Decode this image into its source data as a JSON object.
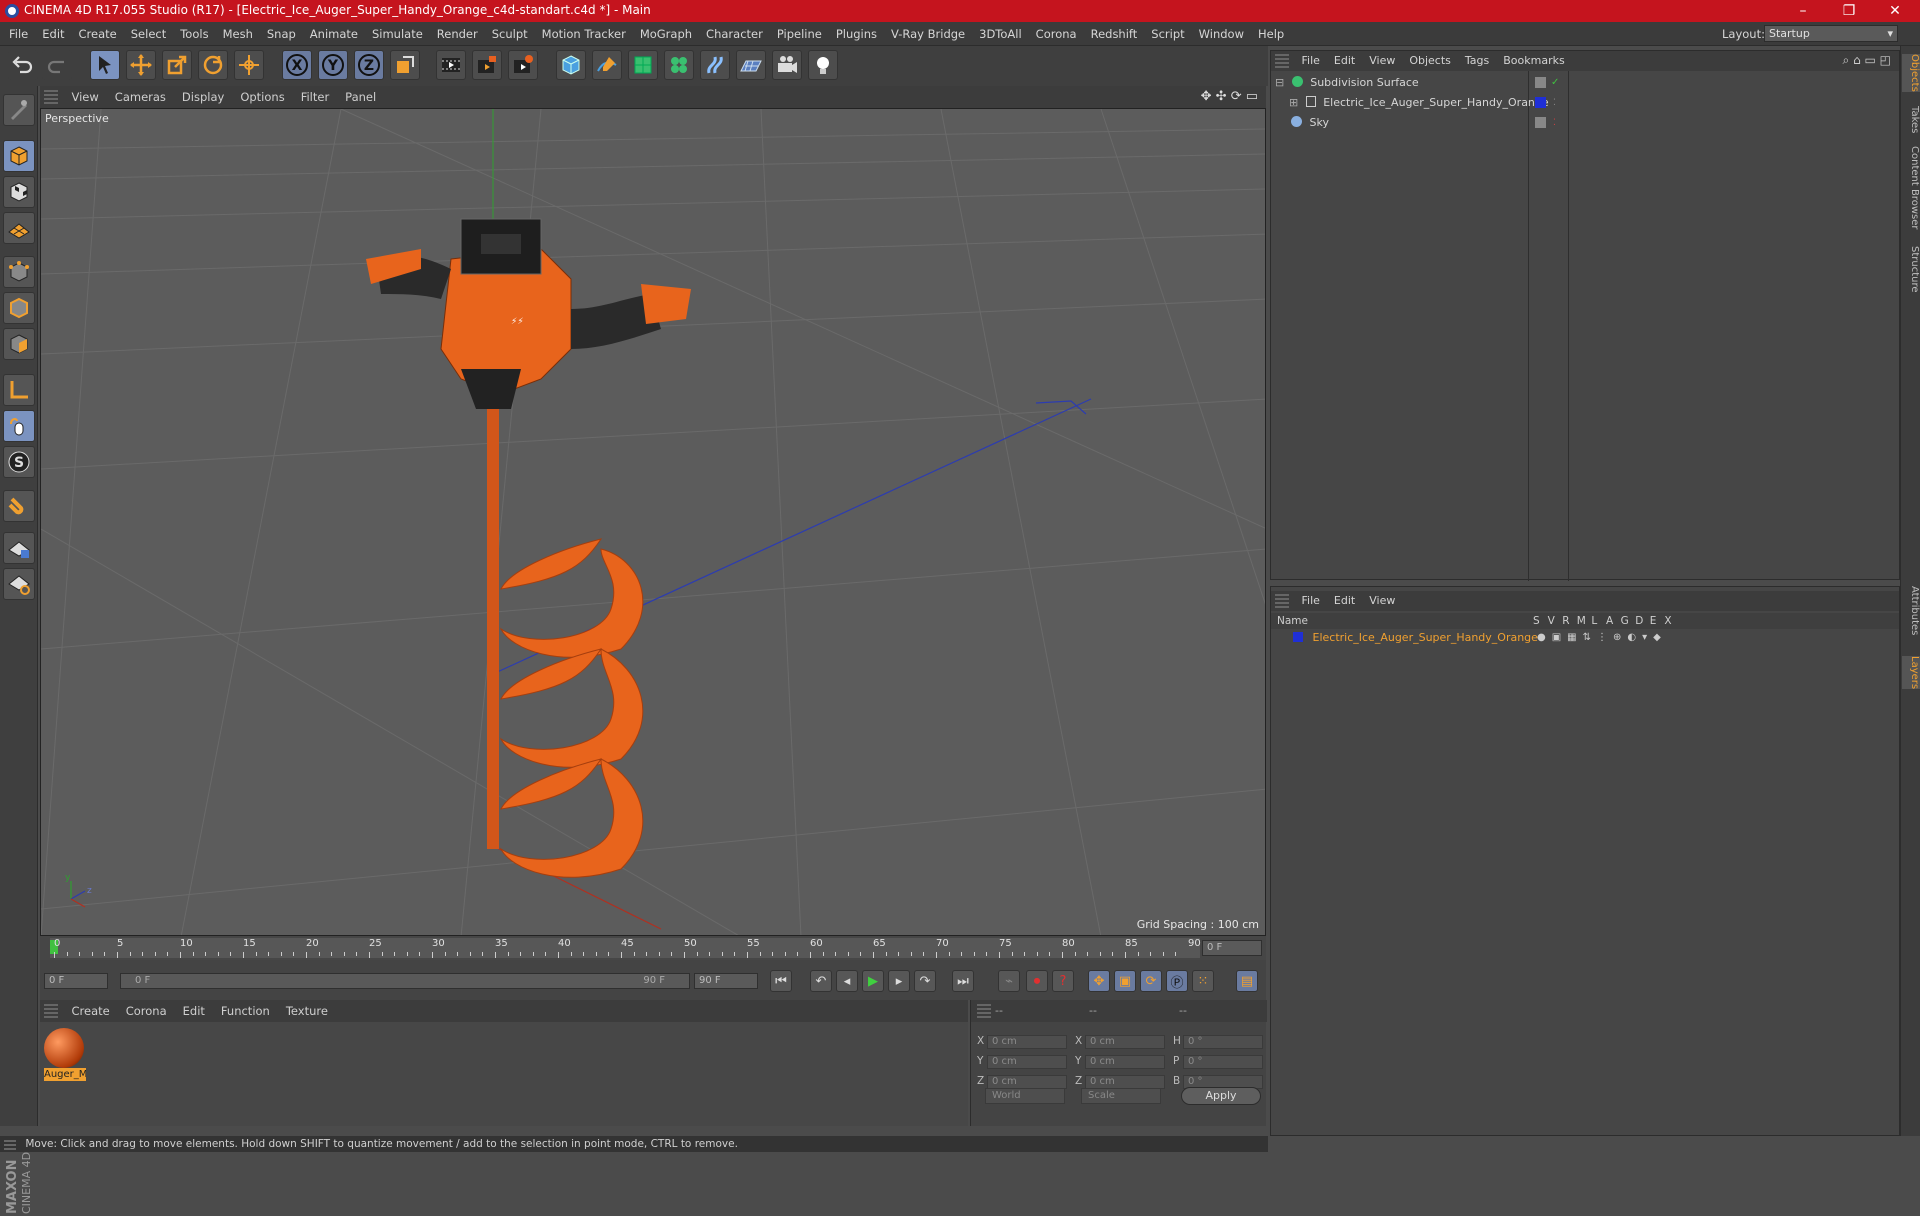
{
  "window": {
    "title": "CINEMA 4D R17.055 Studio (R17) - [Electric_Ice_Auger_Super_Handy_Orange_c4d-standart.c4d *] - Main"
  },
  "menu": {
    "items": [
      "File",
      "Edit",
      "Create",
      "Select",
      "Tools",
      "Mesh",
      "Snap",
      "Animate",
      "Simulate",
      "Render",
      "Sculpt",
      "Motion Tracker",
      "MoGraph",
      "Character",
      "Pipeline",
      "Plugins",
      "V-Ray Bridge",
      "3DToAll",
      "Corona",
      "Redshift",
      "Script",
      "Window",
      "Help"
    ],
    "layout_label": "Layout:",
    "layout_value": "Startup"
  },
  "viewport": {
    "menu": [
      "View",
      "Cameras",
      "Display",
      "Options",
      "Filter",
      "Panel"
    ],
    "label": "Perspective",
    "grid_spacing": "Grid Spacing : 100 cm"
  },
  "timeline": {
    "ticks": [
      "0",
      "5",
      "10",
      "15",
      "20",
      "25",
      "30",
      "35",
      "40",
      "45",
      "50",
      "55",
      "60",
      "65",
      "70",
      "75",
      "80",
      "85",
      "90"
    ],
    "current_frame": "0 F",
    "start_field": "0 F",
    "range_start": "0 F",
    "range_end": "90 F",
    "end_field": "90 F"
  },
  "material": {
    "menu": [
      "Create",
      "Corona",
      "Edit",
      "Function",
      "Texture"
    ],
    "name": "Auger_M"
  },
  "coords": {
    "header1": "--",
    "header2": "--",
    "header3": "--",
    "rows": [
      {
        "a": "X",
        "av": "0 cm",
        "b": "X",
        "bv": "0 cm",
        "c": "H",
        "cv": "0 °"
      },
      {
        "a": "Y",
        "av": "0 cm",
        "b": "Y",
        "bv": "0 cm",
        "c": "P",
        "cv": "0 °"
      },
      {
        "a": "Z",
        "av": "0 cm",
        "b": "Z",
        "bv": "0 cm",
        "c": "B",
        "cv": "0 °"
      }
    ],
    "world": "World",
    "scale": "Scale",
    "apply": "Apply"
  },
  "objects": {
    "menu": [
      "File",
      "Edit",
      "View",
      "Objects",
      "Tags",
      "Bookmarks"
    ],
    "items": [
      "Subdivision Surface",
      "Electric_Ice_Auger_Super_Handy_Orange",
      "Sky"
    ]
  },
  "layers": {
    "menu": [
      "File",
      "Edit",
      "View"
    ],
    "col_name": "Name",
    "cols": [
      "S",
      "V",
      "R",
      "M",
      "L",
      "A",
      "G",
      "D",
      "E",
      "X"
    ],
    "item": "Electric_Ice_Auger_Super_Handy_Orange"
  },
  "right_tabs": [
    "Objects",
    "Takes",
    "Content Browser",
    "Structure",
    "Attributes",
    "Layers"
  ],
  "status": "Move: Click and drag to move elements. Hold down SHIFT to quantize movement / add to the selection in point mode, CTRL to remove.",
  "colors": {
    "title_bar": "#c5141e",
    "accent_orange": "#e8641c",
    "layer_blue": "#1f2fd6",
    "highlight": "#f0a030"
  }
}
